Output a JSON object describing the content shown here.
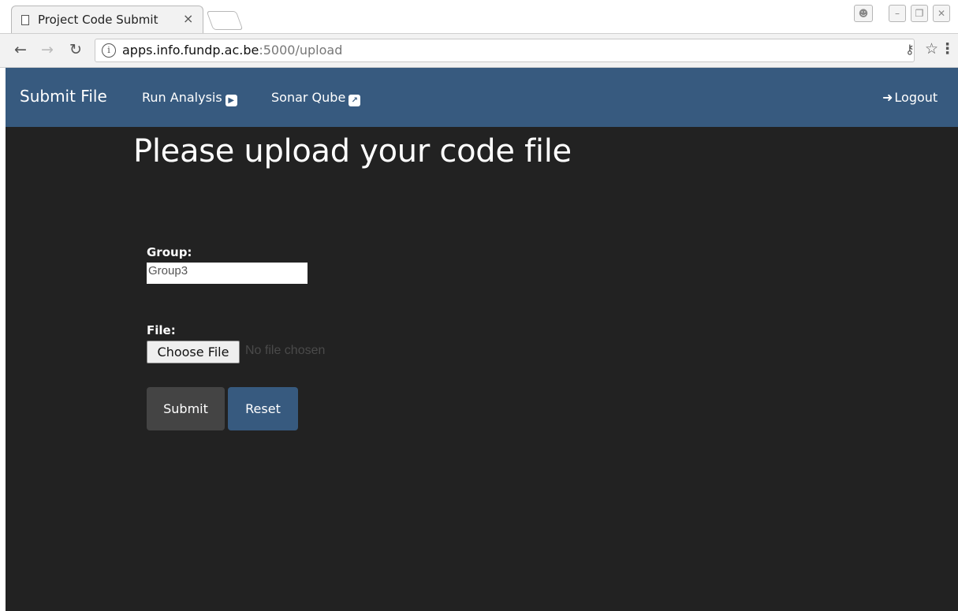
{
  "browser": {
    "tab_title": "Project Code Submit",
    "tab_close": "×",
    "url_host": "apps.info.fundp.ac.be",
    "url_path": ":5000/upload",
    "icons": [
      "back-icon",
      "forward-icon",
      "reload-icon",
      "info-icon",
      "key-icon",
      "star-icon",
      "menu-icon",
      "page-icon",
      "profile-icon",
      "minimize-icon",
      "restore-icon",
      "close-icon"
    ]
  },
  "navbar": {
    "brand": "Submit File",
    "run_analysis": "Run Analysis",
    "sonar_qube": "Sonar Qube",
    "logout": "Logout",
    "background_color": "#375a7f"
  },
  "page": {
    "heading": "Please upload your code file",
    "group_label": "Group:",
    "group_value": "Group3",
    "file_label": "File:",
    "choose_file": "Choose File",
    "no_file": "No file chosen",
    "submit": "Submit",
    "reset": "Reset",
    "background_color": "#222222"
  }
}
